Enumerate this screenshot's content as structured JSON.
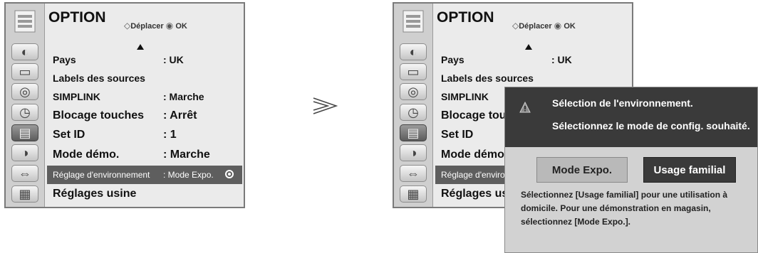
{
  "left_menu": {
    "title": "OPTION",
    "hint": "Déplacer",
    "hint_ok": "OK",
    "rows": [
      {
        "label": "Pays",
        "value": ": UK"
      },
      {
        "label": "Labels des sources",
        "value": ""
      },
      {
        "label": "SIMPLINK",
        "value": ": Marche"
      },
      {
        "label": "Blocage touches",
        "value": ": Arrêt"
      },
      {
        "label": "Set ID",
        "value": ": 1"
      },
      {
        "label": "Mode démo.",
        "value": ": Marche"
      },
      {
        "label": "Réglage d'environnement",
        "value": ": Mode Expo."
      },
      {
        "label": "Réglages usine",
        "value": ""
      }
    ]
  },
  "right_menu": {
    "title": "OPTION",
    "hint": "Déplacer",
    "hint_ok": "OK",
    "rows": [
      {
        "label": "Pays",
        "value": ": UK"
      },
      {
        "label": "Labels des sources",
        "value": ""
      },
      {
        "label": "SIMPLINK",
        "value": ""
      },
      {
        "label": "Blocage tou",
        "value": ""
      },
      {
        "label": "Set ID",
        "value": ""
      },
      {
        "label": "Mode démo",
        "value": ""
      },
      {
        "label": "Réglage d'enviro",
        "value": ""
      },
      {
        "label": "Réglages us",
        "value": ""
      }
    ]
  },
  "dialog": {
    "line1": "Sélection de l'environnement.",
    "line2": "Sélectionnez le mode de config. souhaité.",
    "button_expo": "Mode Expo.",
    "button_home": "Usage familial",
    "description": "Sélectionnez [Usage familial] pour une utilisation à domicile. Pour une démonstration en magasin, sélectionnez [Mode Expo.]."
  },
  "icons": [
    "option-icon",
    "picture-icon",
    "screen-icon",
    "audio-icon",
    "time-icon",
    "option-icon",
    "lock-icon",
    "input-icon",
    "usb-icon"
  ],
  "colors": {
    "highlight": "#5e5e5e",
    "dialog_header": "#3a3a3a",
    "panel_bg": "#ebebeb"
  }
}
